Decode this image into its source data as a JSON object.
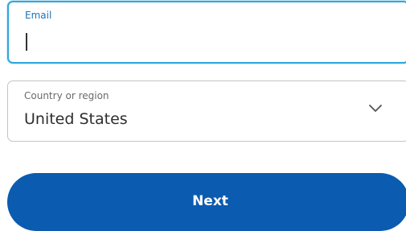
{
  "email": {
    "label": "Email",
    "value": ""
  },
  "country": {
    "label": "Country or region",
    "value": "United States",
    "icon": "chevron-down-icon"
  },
  "next_button": {
    "label": "Next"
  },
  "colors": {
    "focus_border": "#2fa8dd",
    "email_label": "#1a73b8",
    "button_bg": "#0b5bb0",
    "button_text": "#ffffff",
    "field_border": "#c4c4c4"
  }
}
